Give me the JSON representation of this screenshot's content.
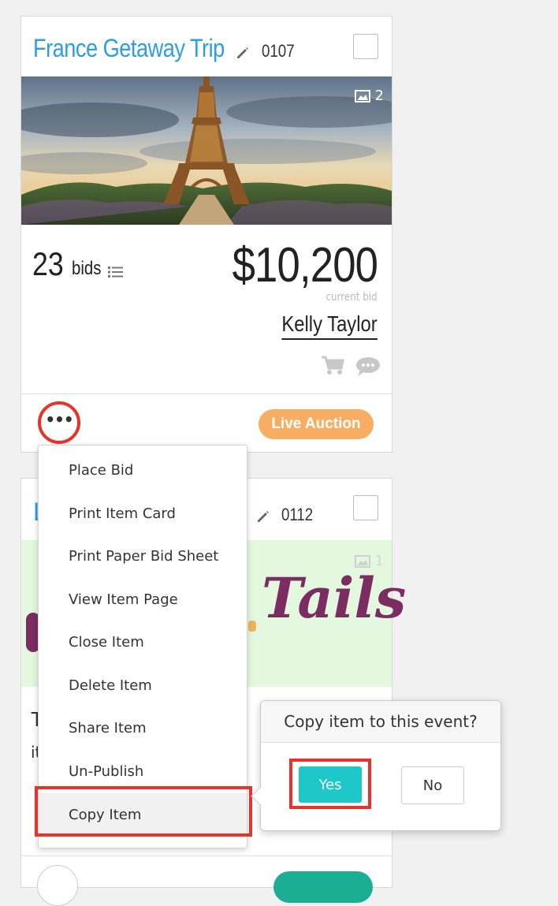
{
  "card1": {
    "title": "France Getaway Trip",
    "item_number": "0107",
    "image_count": "2",
    "bid_count": "23",
    "bids_label": "bids",
    "price": "$10,200",
    "price_caption": "current bid",
    "bidder": "Kelly Taylor",
    "badge": "Live Auction",
    "more_label": "•••"
  },
  "card2": {
    "title_fragment": "L",
    "item_number": "0112",
    "image_count": "1",
    "logo_text": "Tails",
    "text_fragment_1": "T",
    "text_fragment_2": "it"
  },
  "menu": {
    "items": [
      {
        "label": "Place Bid"
      },
      {
        "label": "Print Item Card"
      },
      {
        "label": "Print Paper Bid Sheet"
      },
      {
        "label": "View Item Page"
      },
      {
        "label": "Close Item"
      },
      {
        "label": "Delete Item"
      },
      {
        "label": "Share Item"
      },
      {
        "label": "Un-Publish"
      },
      {
        "label": "Copy Item"
      }
    ]
  },
  "popover": {
    "title": "Copy item to this event?",
    "yes_label": "Yes",
    "no_label": "No"
  },
  "colors": {
    "title_blue": "#2b9fe4",
    "badge_orange": "#f7ae63",
    "highlight_red": "#e8322b",
    "yes_teal": "#1ec8c8"
  },
  "icons": [
    "pencil-icon",
    "image-icon",
    "list-icon",
    "cart-icon",
    "chat-icon",
    "more-icon"
  ]
}
